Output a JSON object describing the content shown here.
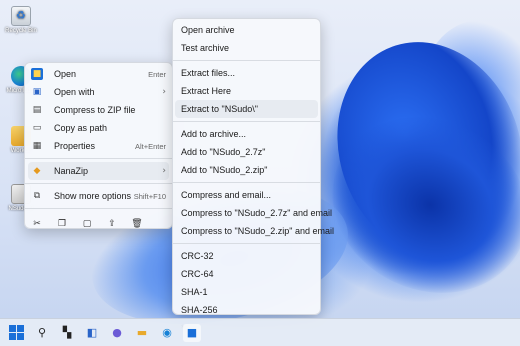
{
  "desktop": {
    "icons": [
      {
        "label": "Recycle Bin",
        "icon": "recycle-bin-icon"
      },
      {
        "label": "Micro Ed...",
        "icon": "edge-icon"
      },
      {
        "label": "Workdir",
        "icon": "folder-icon"
      },
      {
        "label": "NSudo_2",
        "icon": "nsudo-icon"
      }
    ]
  },
  "context_menu": {
    "items": [
      {
        "label": "Open",
        "shortcut": "Enter",
        "icon": "nsudo-app-icon"
      },
      {
        "label": "Open with",
        "arrow": "›",
        "icon": "open-with-icon"
      },
      {
        "label": "Compress to ZIP file",
        "icon": "zip-icon"
      },
      {
        "label": "Copy as path",
        "icon": "copy-path-icon"
      },
      {
        "label": "Properties",
        "shortcut": "Alt+Enter",
        "icon": "properties-icon"
      },
      {
        "label": "NanaZip",
        "arrow": "›",
        "icon": "nanazip-icon"
      },
      {
        "label": "Show more options",
        "shortcut": "Shift+F10",
        "icon": "more-options-icon"
      }
    ],
    "bottom_actions": [
      "cut-icon",
      "copy-icon",
      "rename-icon",
      "share-icon",
      "delete-icon"
    ]
  },
  "submenu": {
    "groups": [
      [
        "Open archive",
        "Test archive"
      ],
      [
        "Extract files...",
        "Extract Here",
        "Extract to \"NSudo\\\""
      ],
      [
        "Add to archive...",
        "Add to \"NSudo_2.7z\"",
        "Add to \"NSudo_2.zip\""
      ],
      [
        "Compress and email...",
        "Compress to \"NSudo_2.7z\" and email",
        "Compress to \"NSudo_2.zip\" and email"
      ],
      [
        "CRC-32",
        "CRC-64",
        "SHA-1",
        "SHA-256",
        "*"
      ]
    ],
    "highlighted": "Extract to \"NSudo\\\""
  },
  "taskbar": {
    "items": [
      "start-icon",
      "search-icon",
      "task-view-icon",
      "widgets-icon",
      "chat-icon",
      "file-explorer-icon",
      "edge-browser-icon",
      "store-icon"
    ]
  },
  "colors": {
    "accent": "#1a6fd8",
    "menu_bg": "#f6f8fc",
    "highlight": "#e7ebf1"
  }
}
